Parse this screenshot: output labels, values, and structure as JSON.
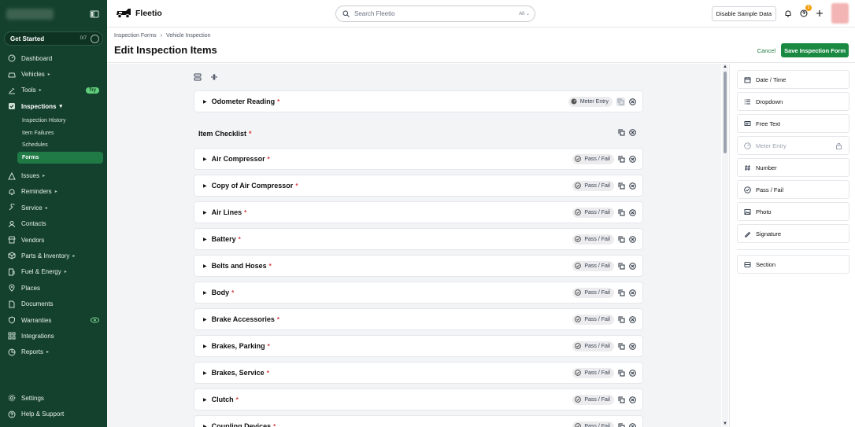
{
  "sidebar": {
    "get_started": {
      "label": "Get Started",
      "progress": "0/7"
    },
    "items": [
      {
        "label": "Dashboard",
        "icon": "dashboard-icon"
      },
      {
        "label": "Vehicles",
        "icon": "car-icon",
        "chevron": "▸"
      },
      {
        "label": "Tools",
        "icon": "tools-icon",
        "chevron": "▸",
        "badge": "Try"
      },
      {
        "label": "Inspections",
        "icon": "checkbox-icon",
        "chevron": "▾"
      },
      {
        "label": "Issues",
        "icon": "warning-icon",
        "chevron": "▸"
      },
      {
        "label": "Reminders",
        "icon": "bell-icon",
        "chevron": "▸"
      },
      {
        "label": "Service",
        "icon": "wrench-icon",
        "chevron": "▸"
      },
      {
        "label": "Contacts",
        "icon": "contacts-icon"
      },
      {
        "label": "Vendors",
        "icon": "vendor-icon"
      },
      {
        "label": "Parts & Inventory",
        "icon": "box-icon",
        "chevron": "▸"
      },
      {
        "label": "Fuel & Energy",
        "icon": "fuel-icon",
        "chevron": "▸"
      },
      {
        "label": "Places",
        "icon": "pin-icon"
      },
      {
        "label": "Documents",
        "icon": "document-icon"
      },
      {
        "label": "Warranties",
        "icon": "shield-icon"
      },
      {
        "label": "Integrations",
        "icon": "integrations-icon"
      },
      {
        "label": "Reports",
        "icon": "reports-icon",
        "chevron": "▸"
      }
    ],
    "inspections_sub": [
      "Inspection History",
      "Item Failures",
      "Schedules",
      "Forms"
    ],
    "bottom": [
      {
        "label": "Settings",
        "icon": "gear-icon"
      },
      {
        "label": "Help & Support",
        "icon": "help-icon"
      }
    ]
  },
  "topbar": {
    "brand": "Fleetio",
    "search_placeholder": "Search Fleetio",
    "search_scope": "All",
    "disable_sample": "Disable Sample Data",
    "help_count": "5"
  },
  "header": {
    "breadcrumb": [
      "Inspection Forms",
      "Vehicle Inspection"
    ],
    "breadcrumb_sep": "›",
    "title": "Edit Inspection Items",
    "cancel": "Cancel",
    "save": "Save Inspection Form"
  },
  "form": {
    "odometer": {
      "label": "Odometer Reading",
      "required": "*",
      "type": "Meter Entry"
    },
    "section": {
      "label": "Item Checklist",
      "required": "*"
    },
    "items": [
      {
        "label": "Air Compressor",
        "required": "*",
        "type": "Pass / Fail"
      },
      {
        "label": "Copy of Air Compressor",
        "required": "*",
        "type": "Pass / Fail"
      },
      {
        "label": "Air Lines",
        "required": "*",
        "type": "Pass / Fail"
      },
      {
        "label": "Battery",
        "required": "*",
        "type": "Pass / Fail"
      },
      {
        "label": "Belts and Hoses",
        "required": "*",
        "type": "Pass / Fail"
      },
      {
        "label": "Body",
        "required": "*",
        "type": "Pass / Fail"
      },
      {
        "label": "Brake Accessories",
        "required": "*",
        "type": "Pass / Fail"
      },
      {
        "label": "Brakes, Parking",
        "required": "*",
        "type": "Pass / Fail"
      },
      {
        "label": "Brakes, Service",
        "required": "*",
        "type": "Pass / Fail"
      },
      {
        "label": "Clutch",
        "required": "*",
        "type": "Pass / Fail"
      },
      {
        "label": "Coupling Devices",
        "required": "*",
        "type": "Pass / Fail"
      }
    ]
  },
  "palette": {
    "items": [
      {
        "label": "Date / Time",
        "icon": "calendar-icon"
      },
      {
        "label": "Dropdown",
        "icon": "list-icon"
      },
      {
        "label": "Free Text",
        "icon": "text-icon"
      },
      {
        "label": "Meter Entry",
        "icon": "meter-icon",
        "disabled": true
      },
      {
        "label": "Number",
        "icon": "hash-icon"
      },
      {
        "label": "Pass / Fail",
        "icon": "check-circle-icon"
      },
      {
        "label": "Photo",
        "icon": "photo-icon"
      },
      {
        "label": "Signature",
        "icon": "signature-icon"
      }
    ],
    "section": {
      "label": "Section",
      "icon": "section-icon"
    }
  },
  "colors": {
    "sidebar": "#14412d",
    "accent": "#1a8a43",
    "required": "#d43b3b"
  }
}
